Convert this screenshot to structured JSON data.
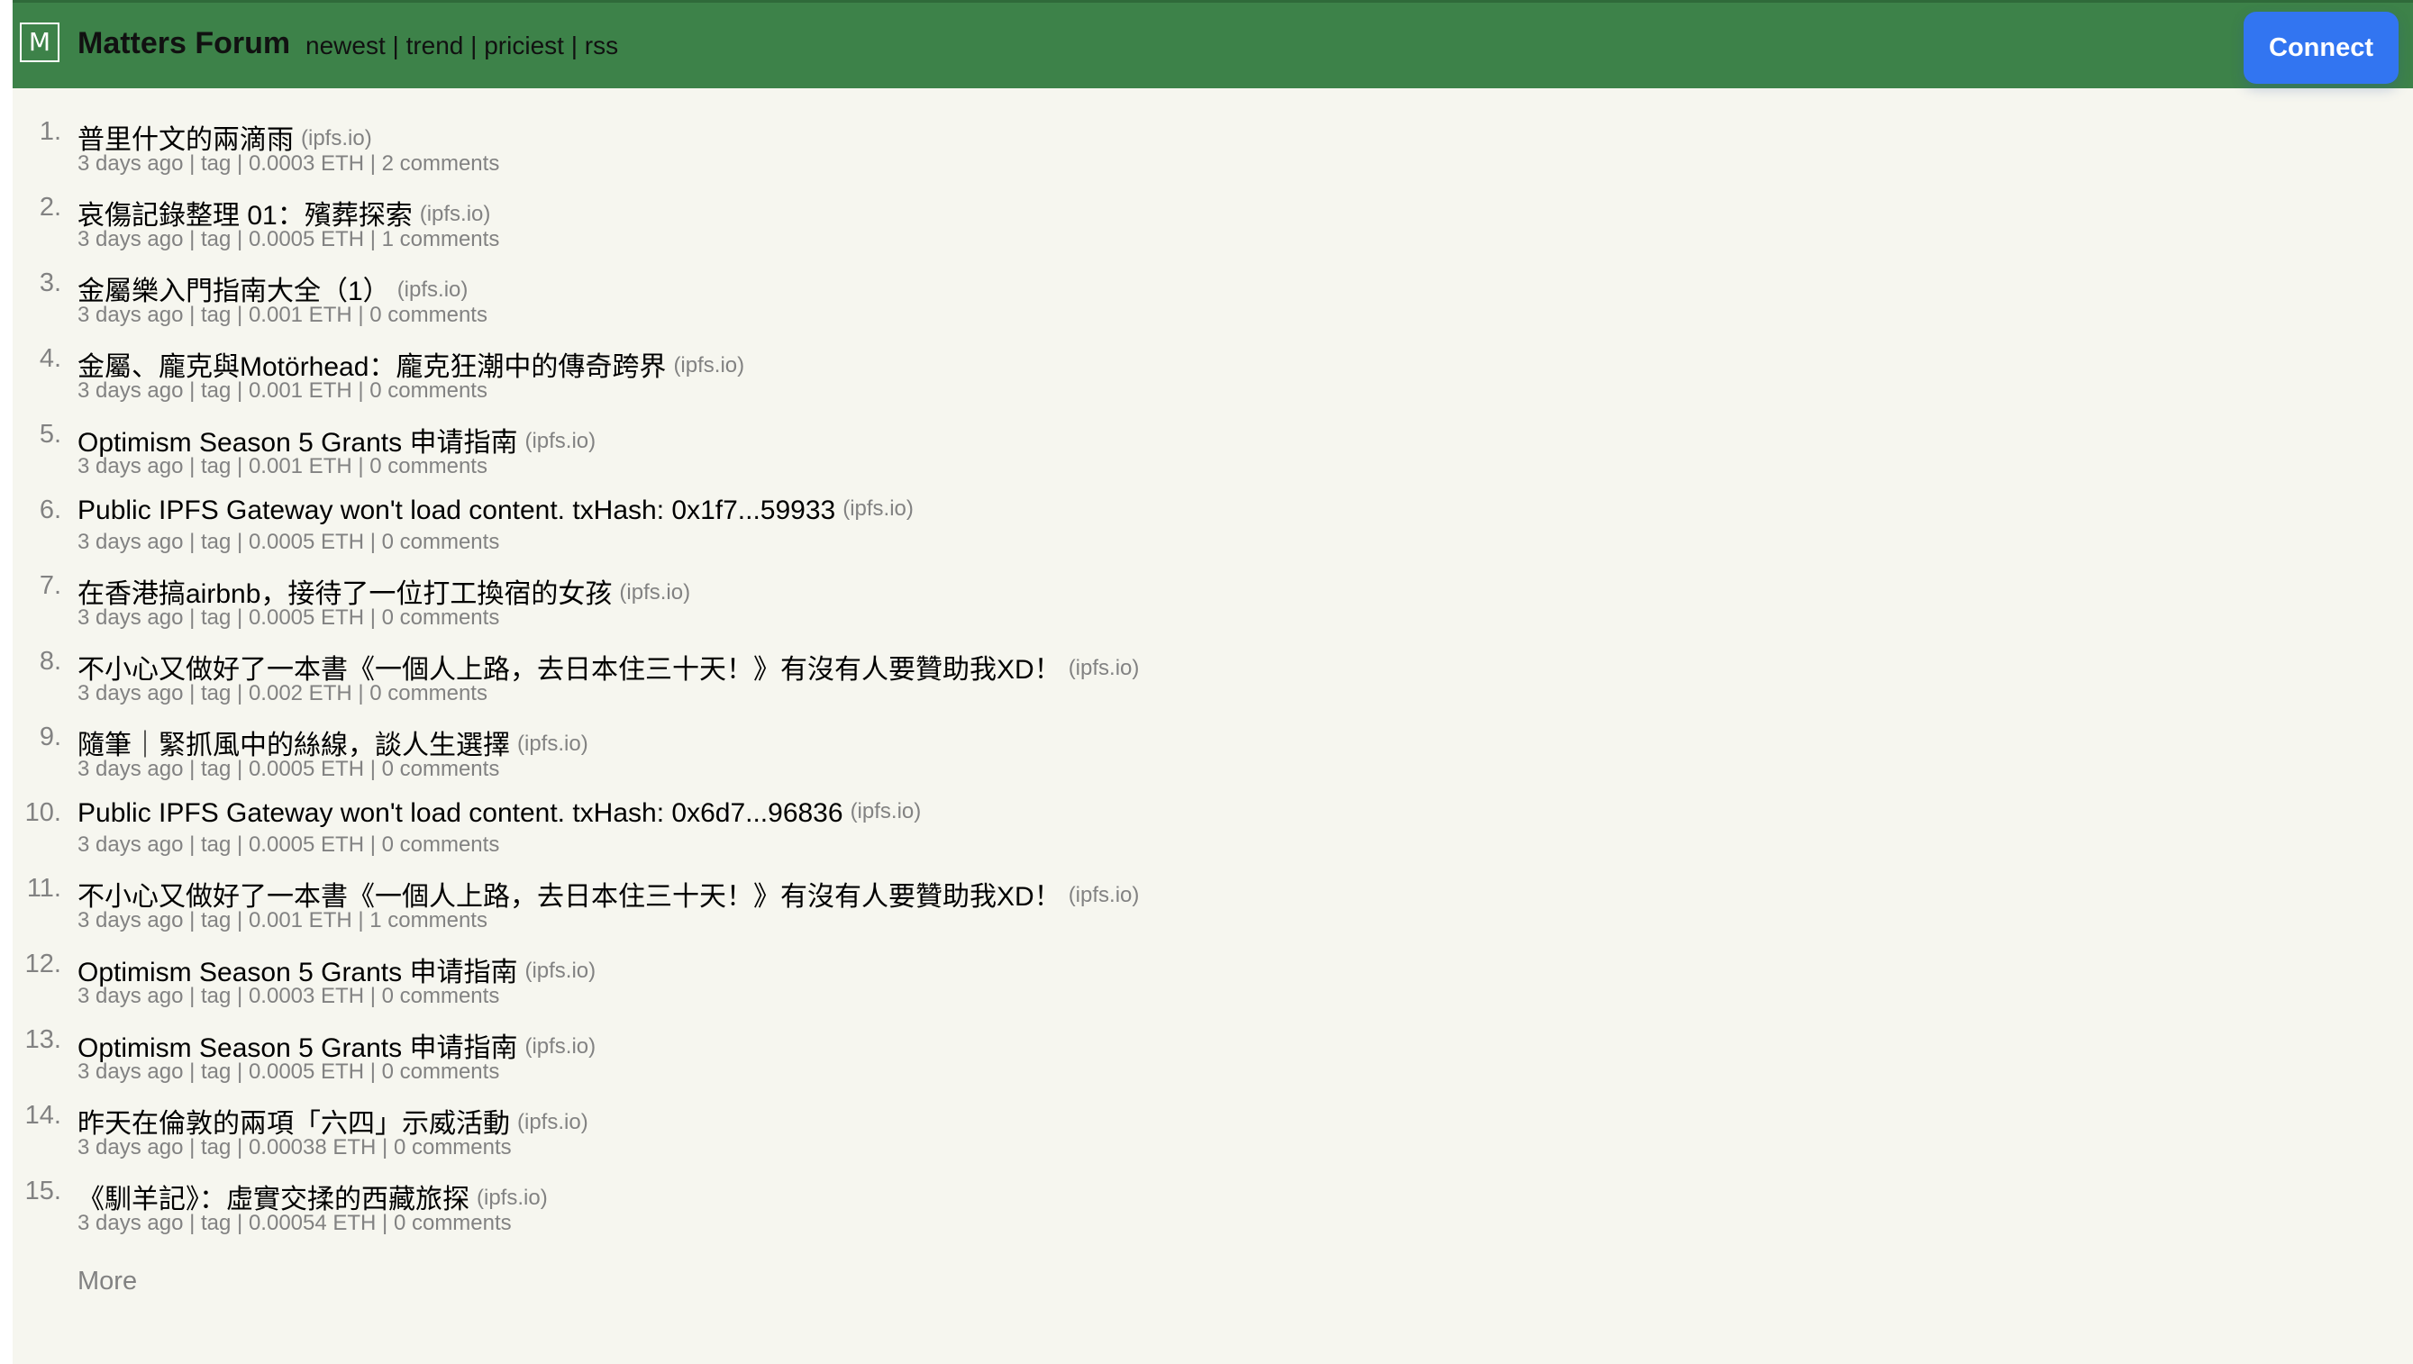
{
  "header": {
    "logo_letter": "M",
    "site_title": "Matters Forum",
    "nav": {
      "newest": "newest",
      "trend": "trend",
      "priciest": "priciest",
      "rss": "rss",
      "separator": "|"
    },
    "connect_label": "Connect"
  },
  "items": [
    {
      "rank": "1.",
      "title": "普里什文的兩滴雨",
      "domain": "(ipfs.io)",
      "age": "3 days ago",
      "tag": "tag",
      "price": "0.0003 ETH",
      "comments": "2 comments"
    },
    {
      "rank": "2.",
      "title": "哀傷記錄整理 01：殯葬探索",
      "domain": "(ipfs.io)",
      "age": "3 days ago",
      "tag": "tag",
      "price": "0.0005 ETH",
      "comments": "1 comments"
    },
    {
      "rank": "3.",
      "title": "金屬樂入門指南大全（1）",
      "domain": "(ipfs.io)",
      "age": "3 days ago",
      "tag": "tag",
      "price": "0.001 ETH",
      "comments": "0 comments"
    },
    {
      "rank": "4.",
      "title": "金屬、龐克與Motörhead：龐克狂潮中的傳奇跨界",
      "domain": "(ipfs.io)",
      "age": "3 days ago",
      "tag": "tag",
      "price": "0.001 ETH",
      "comments": "0 comments"
    },
    {
      "rank": "5.",
      "title": "Optimism Season 5 Grants 申请指南",
      "domain": "(ipfs.io)",
      "age": "3 days ago",
      "tag": "tag",
      "price": "0.001 ETH",
      "comments": "0 comments"
    },
    {
      "rank": "6.",
      "title": "Public IPFS Gateway won't load content. txHash: 0x1f7...59933",
      "domain": "(ipfs.io)",
      "age": "3 days ago",
      "tag": "tag",
      "price": "0.0005 ETH",
      "comments": "0 comments"
    },
    {
      "rank": "7.",
      "title": "在香港搞airbnb，接待了一位打工換宿的女孩",
      "domain": "(ipfs.io)",
      "age": "3 days ago",
      "tag": "tag",
      "price": "0.0005 ETH",
      "comments": "0 comments"
    },
    {
      "rank": "8.",
      "title": "不小心又做好了一本書《一個人上路，去日本住三十天！》有沒有人要贊助我XD！",
      "domain": "(ipfs.io)",
      "age": "3 days ago",
      "tag": "tag",
      "price": "0.002 ETH",
      "comments": "0 comments"
    },
    {
      "rank": "9.",
      "title": "隨筆｜緊抓風中的絲線，談人生選擇",
      "domain": "(ipfs.io)",
      "age": "3 days ago",
      "tag": "tag",
      "price": "0.0005 ETH",
      "comments": "0 comments"
    },
    {
      "rank": "10.",
      "title": "Public IPFS Gateway won't load content. txHash: 0x6d7...96836",
      "domain": "(ipfs.io)",
      "age": "3 days ago",
      "tag": "tag",
      "price": "0.0005 ETH",
      "comments": "0 comments"
    },
    {
      "rank": "11.",
      "title": "不小心又做好了一本書《一個人上路，去日本住三十天！》有沒有人要贊助我XD！",
      "domain": "(ipfs.io)",
      "age": "3 days ago",
      "tag": "tag",
      "price": "0.001 ETH",
      "comments": "1 comments"
    },
    {
      "rank": "12.",
      "title": "Optimism Season 5 Grants 申请指南",
      "domain": "(ipfs.io)",
      "age": "3 days ago",
      "tag": "tag",
      "price": "0.0003 ETH",
      "comments": "0 comments"
    },
    {
      "rank": "13.",
      "title": "Optimism Season 5 Grants 申请指南",
      "domain": "(ipfs.io)",
      "age": "3 days ago",
      "tag": "tag",
      "price": "0.0005 ETH",
      "comments": "0 comments"
    },
    {
      "rank": "14.",
      "title": "昨天在倫敦的兩項「六四」示威活動",
      "domain": "(ipfs.io)",
      "age": "3 days ago",
      "tag": "tag",
      "price": "0.00038 ETH",
      "comments": "0 comments"
    },
    {
      "rank": "15.",
      "title": "《馴羊記》：虛實交揉的西藏旅探",
      "domain": "(ipfs.io)",
      "age": "3 days ago",
      "tag": "tag",
      "price": "0.00054 ETH",
      "comments": "0 comments"
    }
  ],
  "more_label": "More",
  "colors": {
    "header_bg": "#3d8249",
    "page_bg": "#f6f6ef",
    "connect_bg": "#3275f1",
    "muted_text": "#828282"
  }
}
